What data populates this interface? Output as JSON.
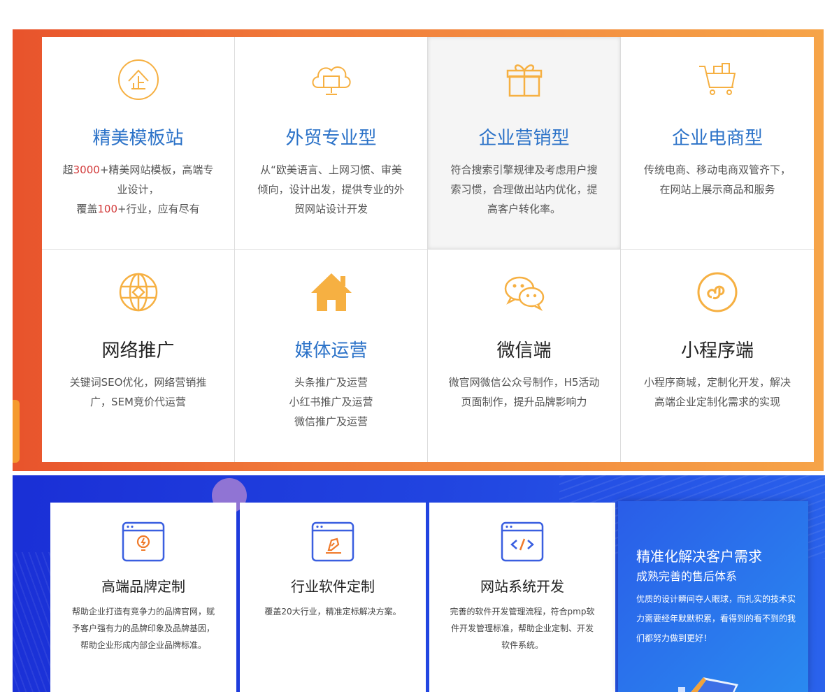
{
  "services": [
    {
      "title": "精美模板站",
      "title_color": "blue",
      "icon": "enterprise-circle-icon",
      "desc": [
        {
          "t": "超"
        },
        {
          "t": "3000",
          "hl": true
        },
        {
          "t": "+精美网站模板，高端专业设计，"
        },
        {
          "t": "覆盖"
        },
        {
          "t": "100",
          "hl": true
        },
        {
          "t": "+行业，应有尽有"
        }
      ]
    },
    {
      "title": "外贸专业型",
      "title_color": "blue",
      "icon": "cloud-monitor-icon",
      "desc": [
        {
          "t": "从“欧美语言、上网习惯、审美倾向，设计出发，提供专业的外贸网站设计开发"
        }
      ]
    },
    {
      "title": "企业营销型",
      "title_color": "blue",
      "icon": "gift-box-icon",
      "desc": [
        {
          "t": "符合搜索引擎规律及考虑用户搜索习惯，合理做出站内优化，提高客户转化率。"
        }
      ]
    },
    {
      "title": "企业电商型",
      "title_color": "blue",
      "icon": "shopping-cart-icon",
      "desc": [
        {
          "t": "传统电商、移动电商双管齐下，在网站上展示商品和服务"
        }
      ]
    },
    {
      "title": "网络推广",
      "title_color": "dark",
      "icon": "globe-icon",
      "desc": [
        {
          "t": "关键词SEO优化，网络营销推广，SEM竞价代运营"
        }
      ]
    },
    {
      "title": "媒体运营",
      "title_color": "blue",
      "icon": "home-icon",
      "desc": [
        {
          "t": "头条推广及运营"
        },
        {
          "t": "小红书推广及运营"
        },
        {
          "t": "微信推广及运营"
        }
      ]
    },
    {
      "title": "微信端",
      "title_color": "dark",
      "icon": "wechat-icon",
      "desc": [
        {
          "t": "微官网微信公众号制作，H5活动页面制作，提升品牌影响力"
        }
      ]
    },
    {
      "title": "小程序端",
      "title_color": "dark",
      "icon": "mini-program-icon",
      "desc": [
        {
          "t": "小程序商城，定制化开发，解决高端企业定制化需求的实现"
        }
      ]
    }
  ],
  "cards": [
    {
      "title": "高端品牌定制",
      "icon": "lightbulb-window-icon",
      "desc": "帮助企业打造有竞争力的品牌官网，赋予客户强有力的品牌印象及品牌基因，帮助企业形成内部企业品牌标准。"
    },
    {
      "title": "行业软件定制",
      "icon": "pen-window-icon",
      "desc": "覆盖20大行业，精准定标解决方案。"
    },
    {
      "title": "网站系统开发",
      "icon": "code-window-icon",
      "desc": "完善的软件开发管理流程，符合pmp软件开发管理标准，帮助企业定制、开发软件系统。"
    }
  ],
  "promo": {
    "heading": "精准化解决客户需求",
    "subheading": "成熟完善的售后体系",
    "text": "优质的设计瞬间夺人眼球，而扎实的技术实力需要经年默默积累，看得到的看不到的我们都努力做到更好！"
  },
  "colors": {
    "accent_orange": "#f6b042",
    "title_blue": "#2b72c8",
    "band_blue": "#1a2fd6",
    "highlight_red": "#d23a3a"
  }
}
